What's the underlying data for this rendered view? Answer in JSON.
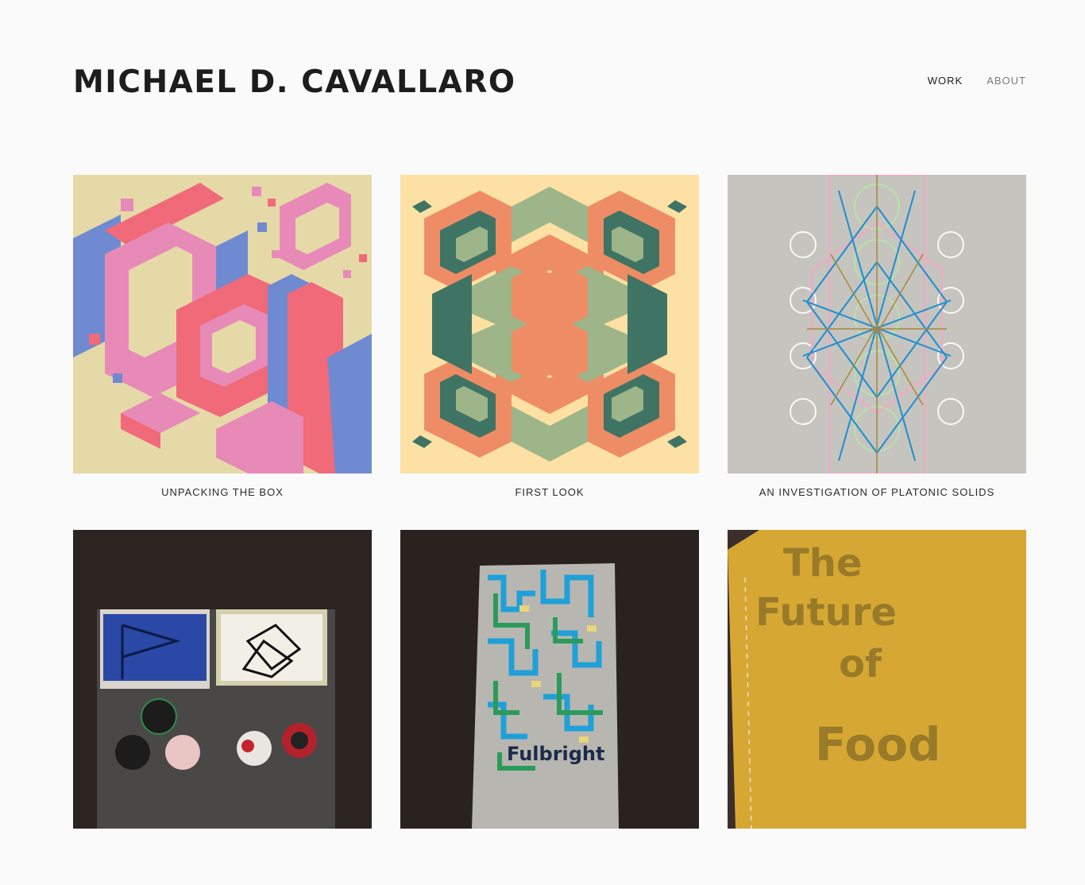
{
  "header": {
    "site_title": "MICHAEL D. CAVALLARO",
    "nav": [
      {
        "label": "WORK",
        "active": true
      },
      {
        "label": "ABOUT",
        "active": false
      }
    ]
  },
  "projects": [
    {
      "title": "UNPACKING THE BOX",
      "image": "isometric-boxes-pattern"
    },
    {
      "title": "FIRST LOOK",
      "image": "symmetric-isometric-pattern"
    },
    {
      "title": "AN INVESTIGATION OF PLATONIC SOLIDS",
      "image": "geometric-line-drawing"
    },
    {
      "title": "",
      "image": "patch-and-button-packs-photo"
    },
    {
      "title": "",
      "image": "fulbright-booklet-photo",
      "visible_text": "Fulbright"
    },
    {
      "title": "",
      "image": "future-of-food-book-photo",
      "visible_text": "The Future of Food"
    }
  ],
  "colors": {
    "background": "#fafafa",
    "text": "#1d1d1d",
    "nav_inactive": "#7a7a7a"
  }
}
